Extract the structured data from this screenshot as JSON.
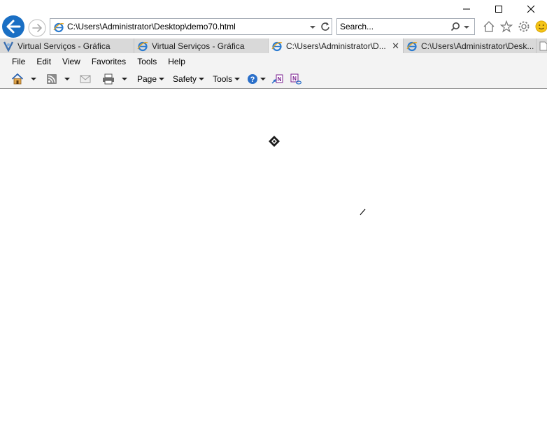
{
  "address": {
    "url": "C:\\Users\\Administrator\\Desktop\\demo70.html"
  },
  "search": {
    "placeholder": "Search..."
  },
  "tabs": [
    {
      "label": "Virtual Serviços - Gráfica",
      "active": false
    },
    {
      "label": "Virtual Serviços - Gráfica",
      "active": false
    },
    {
      "label": "C:\\Users\\Administrator\\D...",
      "active": true
    },
    {
      "label": "C:\\Users\\Administrator\\Desk...",
      "active": false
    }
  ],
  "menu": {
    "file": "File",
    "edit": "Edit",
    "view": "View",
    "favorites": "Favorites",
    "tools": "Tools",
    "help": "Help"
  },
  "commandbar": {
    "page": "Page",
    "safety": "Safety",
    "tools": "Tools"
  },
  "colors": {
    "accent": "#1a6fc4",
    "tab_bar": "#d9d9d9",
    "toolbar": "#f3f3f3"
  }
}
